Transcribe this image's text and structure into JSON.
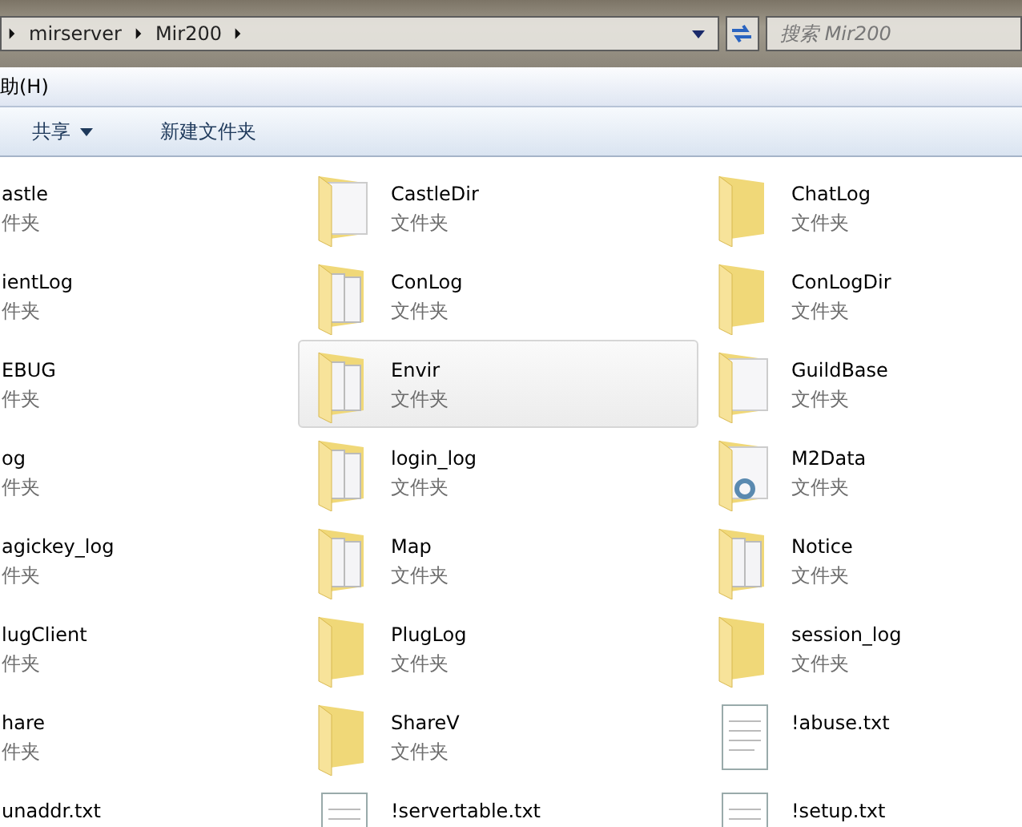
{
  "address_bar": {
    "path": [
      "mirserver",
      "Mir200"
    ]
  },
  "search": {
    "placeholder": "搜索 Mir200"
  },
  "menu": [
    "助(H)"
  ],
  "toolbar": [
    {
      "label": "共享",
      "dropdown": true
    },
    {
      "label": "新建文件夹",
      "dropdown": false
    }
  ],
  "items": [
    {
      "name": "astle",
      "type": "件夹",
      "selected": false
    },
    {
      "name": "CastleDir",
      "type": "文件夹",
      "kind": "paper",
      "selected": false
    },
    {
      "name": "ChatLog",
      "type": "文件夹",
      "kind": "folder",
      "selected": false
    },
    {
      "name": "ientLog",
      "type": "件夹",
      "selected": false
    },
    {
      "name": "ConLog",
      "type": "文件夹",
      "kind": "docs",
      "selected": false
    },
    {
      "name": "ConLogDir",
      "type": "文件夹",
      "kind": "folder",
      "selected": false
    },
    {
      "name": "EBUG",
      "type": "件夹",
      "selected": false
    },
    {
      "name": "Envir",
      "type": "文件夹",
      "kind": "docs",
      "selected": true
    },
    {
      "name": "GuildBase",
      "type": "文件夹",
      "kind": "paper",
      "selected": false
    },
    {
      "name": "og",
      "type": "件夹",
      "selected": false
    },
    {
      "name": "login_log",
      "type": "文件夹",
      "kind": "docs",
      "selected": false
    },
    {
      "name": "M2Data",
      "type": "文件夹",
      "kind": "gear",
      "selected": false
    },
    {
      "name": "agickey_log",
      "type": "件夹",
      "selected": false
    },
    {
      "name": "Map",
      "type": "文件夹",
      "kind": "docs",
      "selected": false
    },
    {
      "name": "Notice",
      "type": "文件夹",
      "kind": "docs",
      "selected": false
    },
    {
      "name": "lugClient",
      "type": "件夹",
      "selected": false
    },
    {
      "name": "PlugLog",
      "type": "文件夹",
      "kind": "folder",
      "selected": false
    },
    {
      "name": "session_log",
      "type": "文件夹",
      "kind": "folder",
      "selected": false
    },
    {
      "name": "hare",
      "type": "件夹",
      "selected": false
    },
    {
      "name": "ShareV",
      "type": "文件夹",
      "kind": "folder",
      "selected": false
    },
    {
      "name": "!abuse.txt",
      "kind": "text",
      "selected": false
    },
    {
      "name": "unaddr.txt",
      "selected": false
    },
    {
      "name": "!servertable.txt",
      "kind": "text",
      "selected": false
    },
    {
      "name": "!setup.txt",
      "kind": "text",
      "selected": false
    }
  ]
}
